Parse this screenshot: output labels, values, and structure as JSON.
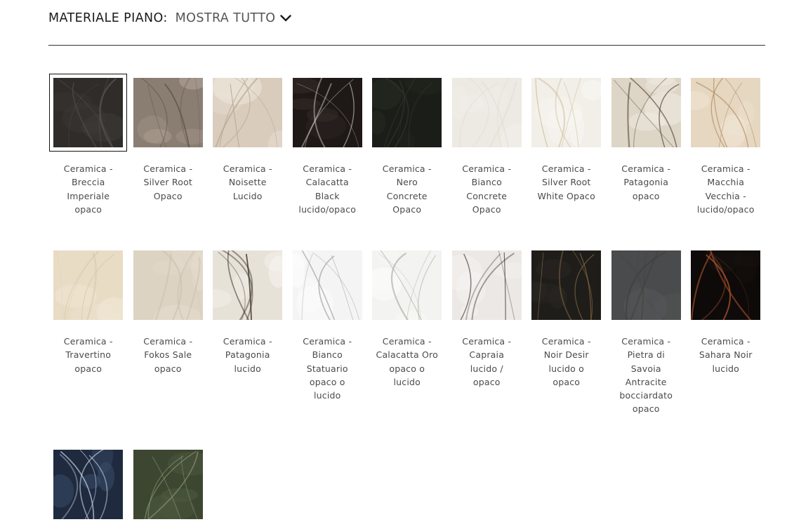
{
  "filter": {
    "label": "MATERIALE PIANO:",
    "value": "MOSTRA TUTTO",
    "icon": "chevron-down-icon"
  },
  "swatches": [
    {
      "caption": "Ceramica -\nBreccia\nImperiale\nopaco",
      "selected": true,
      "colors": [
        "#2f2c29",
        "#3d3a36",
        "#55524d"
      ]
    },
    {
      "caption": "Ceramica -\nSilver Root\nOpaco",
      "colors": [
        "#8a7d72",
        "#b3a597",
        "#5d5349"
      ]
    },
    {
      "caption": "Ceramica -\nNoisette\nLucido",
      "colors": [
        "#d9ccbd",
        "#eee6dc",
        "#b9a893"
      ]
    },
    {
      "caption": "Ceramica -\nCalacatta\nBlack\nlucido/opaco",
      "colors": [
        "#1e1816",
        "#3b302b",
        "#e8e2dc"
      ]
    },
    {
      "caption": "Ceramica -\nNero\nConcrete\nOpaco",
      "colors": [
        "#1b1e18",
        "#262a22",
        "#2f332b"
      ]
    },
    {
      "caption": "Ceramica -\nBianco\nConcrete\nOpaco",
      "colors": [
        "#ede9e3",
        "#f4f1ed",
        "#e2ddd5"
      ]
    },
    {
      "caption": "Ceramica -\nSilver Root\nWhite Opaco",
      "colors": [
        "#f2efe9",
        "#faf8f4",
        "#c9b98f"
      ]
    },
    {
      "caption": "Ceramica -\nPatagonia\nopaco",
      "colors": [
        "#ddd5c6",
        "#f1ece3",
        "#5c4a3b"
      ]
    },
    {
      "caption": "Ceramica -\nMacchia\nVecchia -\nlucido/opaco",
      "colors": [
        "#e6d7c1",
        "#f0e6d6",
        "#b58f66"
      ]
    },
    {
      "caption": "Ceramica -\nTravertino\nopaco",
      "colors": [
        "#e9dcc5",
        "#f1e7d5",
        "#d6c5a8"
      ]
    },
    {
      "caption": "Ceramica -\nFokos Sale\nopaco",
      "colors": [
        "#ddd3c3",
        "#e6ddcf",
        "#cfc4b2"
      ]
    },
    {
      "caption": "Ceramica -\nPatagonia\nlucido",
      "colors": [
        "#e7e2d8",
        "#f6f3ee",
        "#3e352d"
      ]
    },
    {
      "caption": "Ceramica -\nBianco\nStatuario\nopaco o\nlucido",
      "colors": [
        "#f4f4f4",
        "#ffffff",
        "#a9abad"
      ]
    },
    {
      "caption": "Ceramica -\nCalacatta Oro\nopaco o\nlucido",
      "colors": [
        "#f3f3f1",
        "#fbfbfa",
        "#b3b3a9"
      ]
    },
    {
      "caption": "Ceramica -\nCapraia\nlucido /\nopaco",
      "colors": [
        "#ebe8e5",
        "#f7f6f4",
        "#4c4542"
      ]
    },
    {
      "caption": "Ceramica -\nNoir Desir\nlucido o\nopaco",
      "colors": [
        "#1f1d1a",
        "#2b2824",
        "#9c7a48"
      ]
    },
    {
      "caption": "Ceramica -\nPietra di\nSavoia\nAntracite\nbocciardato\nopaco",
      "colors": [
        "#4a4b4c",
        "#555657",
        "#3e3f40"
      ]
    },
    {
      "caption": "Ceramica -\nSahara Noir\nlucido",
      "colors": [
        "#0d0a09",
        "#171210",
        "#a14f2a"
      ]
    },
    {
      "caption": "",
      "colors": [
        "#1f2a3e",
        "#3c4f6e",
        "#c9d6ea"
      ]
    },
    {
      "caption": "",
      "colors": [
        "#3d4631",
        "#4f5a40",
        "#8e9a79"
      ]
    }
  ]
}
